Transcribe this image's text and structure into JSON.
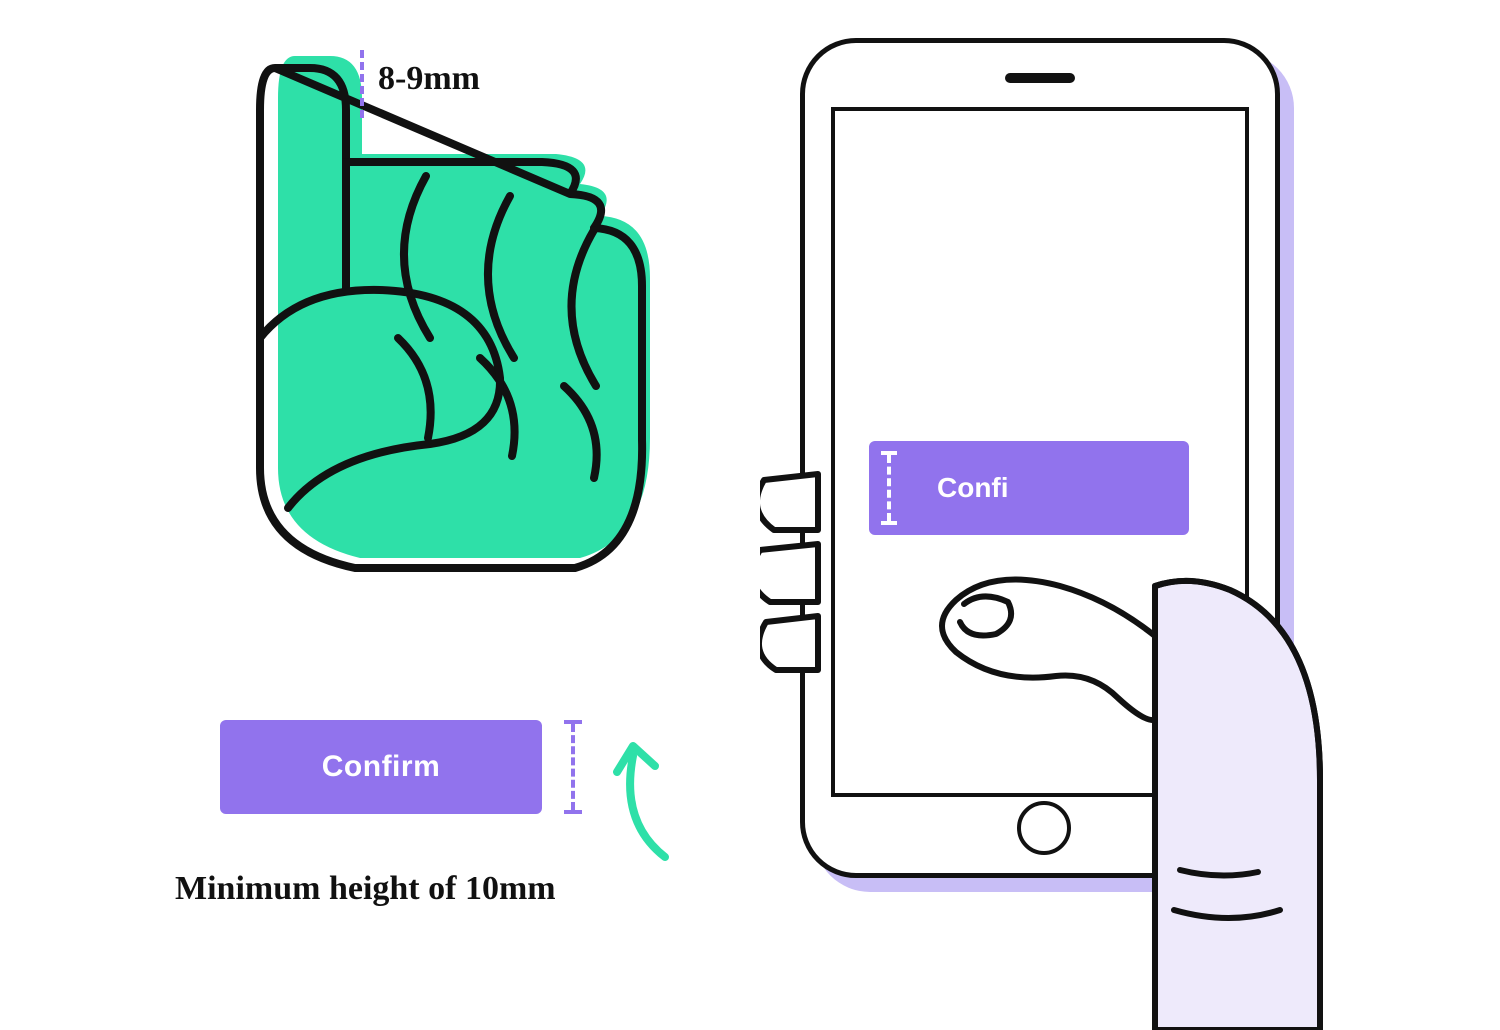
{
  "diagram": {
    "finger_width_label": "8-9mm",
    "min_height_label": "Minimum height of 10mm",
    "button_label": "Confirm",
    "phone_button_label": "Confi"
  },
  "colors": {
    "accent_purple": "#9173ED",
    "accent_teal": "#2EE0A8",
    "ink": "#111111",
    "lavender_shadow": "#C8BEF6"
  }
}
